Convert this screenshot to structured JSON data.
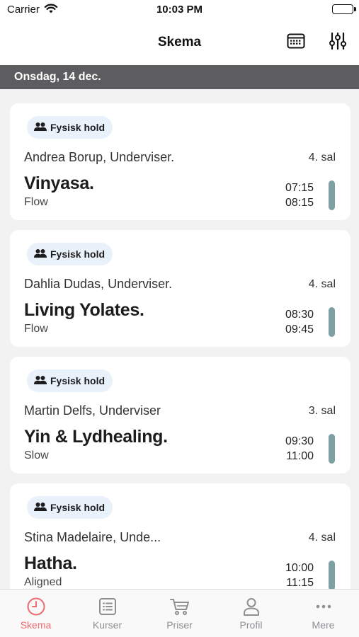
{
  "status_bar": {
    "carrier": "Carrier",
    "time": "10:03 PM"
  },
  "nav": {
    "title": "Skema",
    "icons": [
      "calendar-icon",
      "filter-sliders-icon"
    ]
  },
  "date_header": "Onsdag, 14 dec.",
  "colors": {
    "accent": "#ee6b6f",
    "indicator": "#7fa0a3",
    "badge_bg": "#e9f1fb",
    "header_bg": "#5d5d5f"
  },
  "classes": [
    {
      "badge": "Fysisk hold",
      "instructor": "Andrea Borup, Underviser.",
      "room": "4. sal",
      "title": "Vinyasa.",
      "subtitle": "Flow",
      "start": "07:15",
      "end": "08:15"
    },
    {
      "badge": "Fysisk hold",
      "instructor": "Dahlia Dudas, Underviser.",
      "room": "4. sal",
      "title": "Living Yolates.",
      "subtitle": "Flow",
      "start": "08:30",
      "end": "09:45"
    },
    {
      "badge": "Fysisk hold",
      "instructor": "Martin Delfs, Underviser",
      "room": "3. sal",
      "title": "Yin & Lydhealing.",
      "subtitle": "Slow",
      "start": "09:30",
      "end": "11:00"
    },
    {
      "badge": "Fysisk hold",
      "instructor": "Stina  Madelaire, Unde...",
      "room": "4. sal",
      "title": "Hatha.",
      "subtitle": "Aligned",
      "start": "10:00",
      "end": "11:15"
    }
  ],
  "tabs": [
    {
      "label": "Skema",
      "icon": "clock-icon",
      "active": true
    },
    {
      "label": "Kurser",
      "icon": "list-icon",
      "active": false
    },
    {
      "label": "Priser",
      "icon": "cart-icon",
      "active": false
    },
    {
      "label": "Profil",
      "icon": "person-icon",
      "active": false
    },
    {
      "label": "Mere",
      "icon": "more-dots-icon",
      "active": false
    }
  ]
}
